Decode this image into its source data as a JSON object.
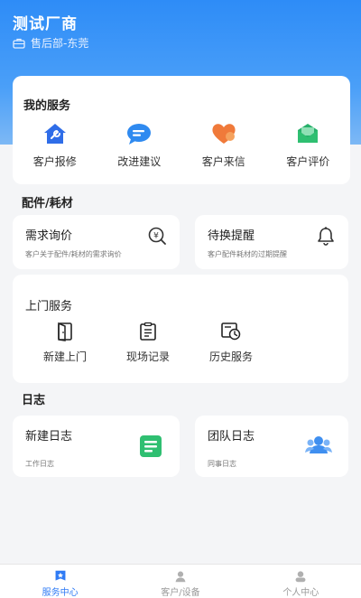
{
  "header": {
    "company": "测试厂商",
    "department": "售后部-东莞"
  },
  "services": {
    "title": "我的服务",
    "items": [
      {
        "label": "客户报修",
        "icon": "wrench-house-icon"
      },
      {
        "label": "改进建议",
        "icon": "chat-bubble-icon"
      },
      {
        "label": "客户来信",
        "icon": "heart-icon"
      },
      {
        "label": "客户评价",
        "icon": "envelope-icon"
      }
    ]
  },
  "parts": {
    "title": "配件/耗材",
    "inquiry": {
      "title": "需求询价",
      "desc": "客户关于配件/耗材的需求询价",
      "icon": "price-search-icon"
    },
    "reminder": {
      "title": "待换提醒",
      "desc": "客户配件耗材的过期提醒",
      "icon": "bell-icon"
    }
  },
  "visit": {
    "title": "上门服务",
    "items": [
      {
        "label": "新建上门",
        "icon": "door-icon"
      },
      {
        "label": "现场记录",
        "icon": "clipboard-icon"
      },
      {
        "label": "历史服务",
        "icon": "history-icon"
      }
    ]
  },
  "log": {
    "title": "日志",
    "new_log": {
      "title": "新建日志",
      "desc": "工作日志",
      "icon": "document-icon"
    },
    "team_log": {
      "title": "团队日志",
      "desc": "同事日志",
      "icon": "team-icon"
    }
  },
  "tabbar": {
    "tabs": [
      {
        "label": "服务中心",
        "active": true
      },
      {
        "label": "客户/设备",
        "active": false
      },
      {
        "label": "个人中心",
        "active": false
      }
    ]
  },
  "colors": {
    "primary": "#2f7bf5",
    "header_gradient_top": "#2e8cf7",
    "orange": "#f07a3a",
    "green": "#2fbf71"
  }
}
